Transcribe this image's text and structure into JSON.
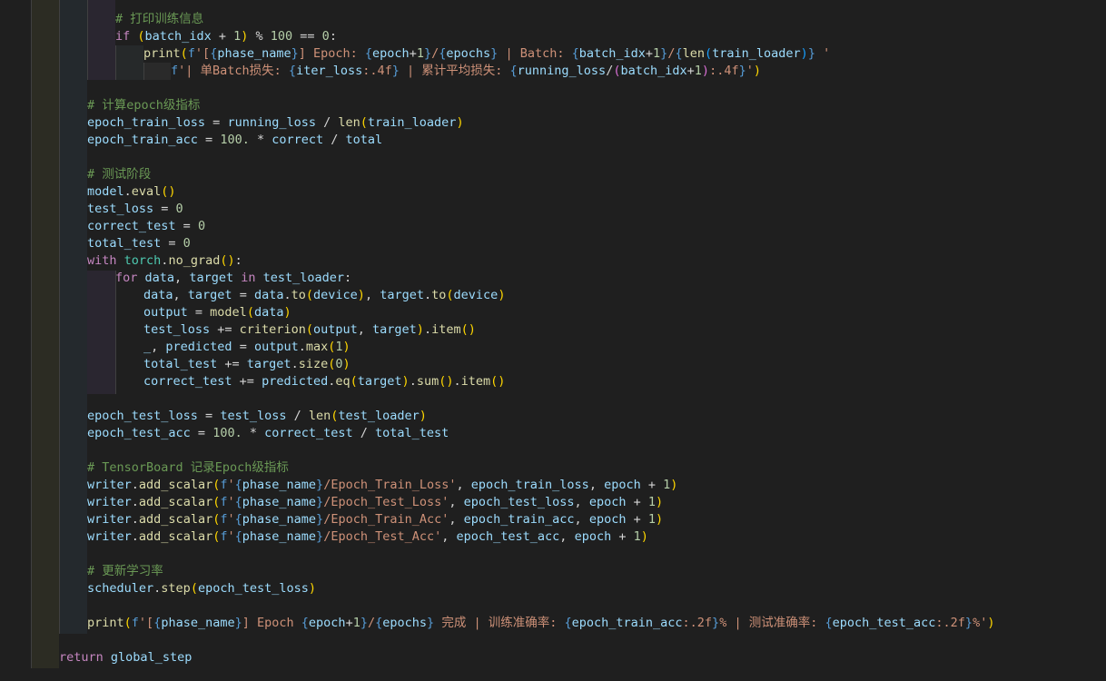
{
  "editor": {
    "lines": [
      {
        "id": "comment-print-train-info",
        "text": "# 打印训练信息"
      },
      {
        "id": "if-batch-idx",
        "text": "if (batch_idx + 1) % 100 == 0:"
      },
      {
        "id": "print-epoch-batch",
        "text": "print(f'[{phase_name}] Epoch: {epoch+1}/{epochs} | Batch: {batch_idx+1}/{len(train_loader)} '"
      },
      {
        "id": "print-loss-cont",
        "text": "f'| 单Batch损失: {iter_loss:.4f} | 累计平均损失: {running_loss/(batch_idx+1):.4f}')"
      },
      {
        "id": "comment-epoch-metrics",
        "text": "# 计算epoch级指标"
      },
      {
        "id": "epoch-train-loss",
        "text": "epoch_train_loss = running_loss / len(train_loader)"
      },
      {
        "id": "epoch-train-acc",
        "text": "epoch_train_acc = 100. * correct / total"
      },
      {
        "id": "comment-test-phase",
        "text": "# 测试阶段"
      },
      {
        "id": "model-eval",
        "text": "model.eval()"
      },
      {
        "id": "test-loss-init",
        "text": "test_loss = 0"
      },
      {
        "id": "correct-test-init",
        "text": "correct_test = 0"
      },
      {
        "id": "total-test-init",
        "text": "total_test = 0"
      },
      {
        "id": "with-no-grad",
        "text": "with torch.no_grad():"
      },
      {
        "id": "for-test-loader",
        "text": "for data, target in test_loader:"
      },
      {
        "id": "to-device",
        "text": "data, target = data.to(device), target.to(device)"
      },
      {
        "id": "model-forward",
        "text": "output = model(data)"
      },
      {
        "id": "test-loss-accum",
        "text": "test_loss += criterion(output, target).item()"
      },
      {
        "id": "predicted-max",
        "text": "_, predicted = output.max(1)"
      },
      {
        "id": "total-test-accum",
        "text": "total_test += target.size(0)"
      },
      {
        "id": "correct-test-accum",
        "text": "correct_test += predicted.eq(target).sum().item()"
      },
      {
        "id": "epoch-test-loss",
        "text": "epoch_test_loss = test_loss / len(test_loader)"
      },
      {
        "id": "epoch-test-acc",
        "text": "epoch_test_acc = 100. * correct_test / total_test"
      },
      {
        "id": "comment-tensorboard",
        "text": "# TensorBoard 记录Epoch级指标"
      },
      {
        "id": "scalar-train-loss",
        "text": "writer.add_scalar(f'{phase_name}/Epoch_Train_Loss', epoch_train_loss, epoch + 1)"
      },
      {
        "id": "scalar-test-loss",
        "text": "writer.add_scalar(f'{phase_name}/Epoch_Test_Loss', epoch_test_loss, epoch + 1)"
      },
      {
        "id": "scalar-train-acc",
        "text": "writer.add_scalar(f'{phase_name}/Epoch_Train_Acc', epoch_train_acc, epoch + 1)"
      },
      {
        "id": "scalar-test-acc",
        "text": "writer.add_scalar(f'{phase_name}/Epoch_Test_Acc', epoch_test_acc, epoch + 1)"
      },
      {
        "id": "comment-update-lr",
        "text": "# 更新学习率"
      },
      {
        "id": "scheduler-step",
        "text": "scheduler.step(epoch_test_loss)"
      },
      {
        "id": "print-epoch-done",
        "text": "print(f'[{phase_name}] Epoch {epoch+1}/{epochs} 完成 | 训练准确率: {epoch_train_acc:.2f}% | 测试准确率: {epoch_test_acc:.2f}%')"
      },
      {
        "id": "return-global-step",
        "text": "return global_step"
      }
    ]
  }
}
